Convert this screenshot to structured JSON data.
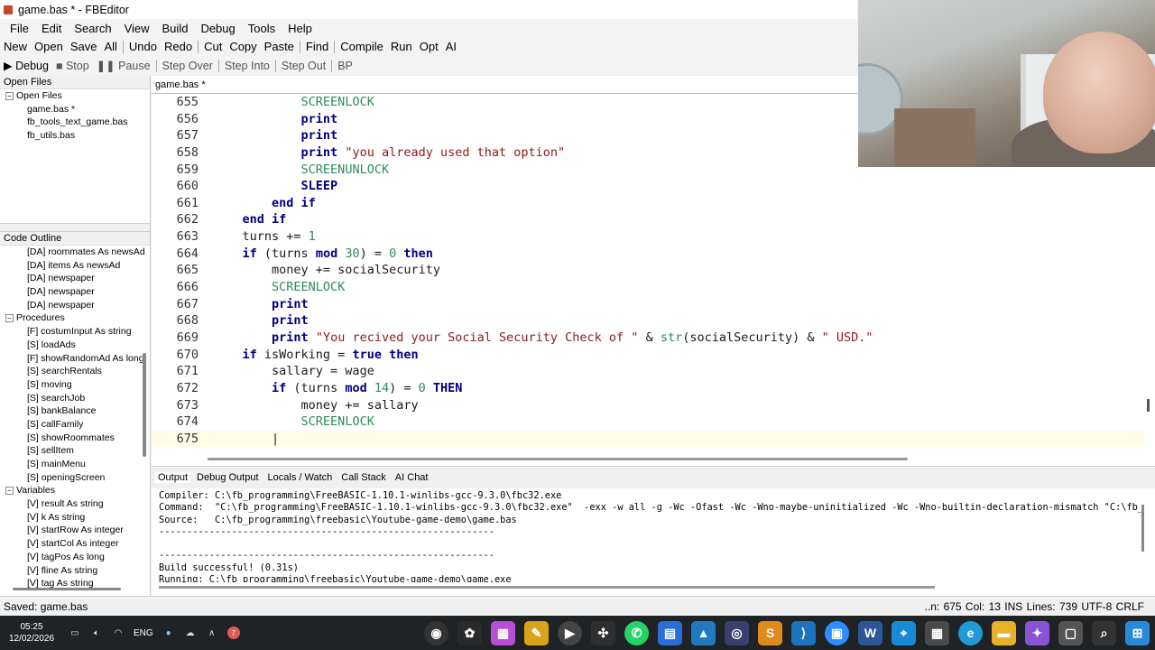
{
  "window": {
    "title": "game.bas * - FBEditor"
  },
  "menu": [
    "File",
    "Edit",
    "Search",
    "View",
    "Build",
    "Debug",
    "Tools",
    "Help"
  ],
  "toolbar": {
    "group1": [
      "New",
      "Open",
      "Save",
      "All"
    ],
    "group2": [
      "Undo",
      "Redo"
    ],
    "group3": [
      "Cut",
      "Copy",
      "Paste"
    ],
    "group4": [
      "Find"
    ],
    "group5": [
      "Compile",
      "Run",
      "Opt",
      "AI"
    ]
  },
  "debugbar": {
    "debug": "▶ Debug",
    "stop": "■ Stop",
    "pause": "❚❚ Pause",
    "step_over": "Step Over",
    "step_into": "Step Into",
    "step_out": "Step Out",
    "bp": "BP"
  },
  "open_files": {
    "header": "Open Files",
    "root": "Open Files",
    "items": [
      "game.bas *",
      "fb_tools_text_game.bas",
      "fb_utils.bas"
    ]
  },
  "code_outline": {
    "header": "Code Outline",
    "top_items": [
      "[DA] roommates As newsAd",
      "[DA] items As newsAd",
      "[DA] newspaper",
      "[DA] newspaper",
      "[DA] newspaper"
    ],
    "procedures_label": "Procedures",
    "procedures": [
      "[F] costumInput As string",
      "[S] loadAds",
      "[F] showRandomAd As long",
      "[S] searchRentals",
      "[S] moving",
      "[S] searchJob",
      "[S] bankBalance",
      "[S] callFamily",
      "[S] showRoommates",
      "[S] sellItem",
      "[S] mainMenu",
      "[S] openingScreen"
    ],
    "variables_label": "Variables",
    "variables": [
      "[V] result As string",
      "[V] k As string",
      "[V] startRow As integer",
      "[V] startCol As integer",
      "[V] tagPos As long",
      "[V] fline As string",
      "[V] tag As string"
    ]
  },
  "editor": {
    "tab": "game.bas *",
    "lines": [
      {
        "n": "655",
        "indent": 12,
        "tokens": [
          [
            "fn",
            "SCREENLOCK"
          ]
        ]
      },
      {
        "n": "656",
        "indent": 12,
        "tokens": [
          [
            "kw",
            "print"
          ]
        ]
      },
      {
        "n": "657",
        "indent": 12,
        "tokens": [
          [
            "kw",
            "print"
          ]
        ]
      },
      {
        "n": "658",
        "indent": 12,
        "tokens": [
          [
            "kw",
            "print"
          ],
          [
            "t",
            " "
          ],
          [
            "str",
            "\"you already used that option\""
          ]
        ]
      },
      {
        "n": "659",
        "indent": 12,
        "tokens": [
          [
            "fn",
            "SCREENUNLOCK"
          ]
        ]
      },
      {
        "n": "660",
        "indent": 12,
        "tokens": [
          [
            "kw",
            "SLEEP"
          ]
        ]
      },
      {
        "n": "661",
        "indent": 8,
        "tokens": [
          [
            "kw",
            "end if"
          ]
        ]
      },
      {
        "n": "662",
        "indent": 4,
        "tokens": [
          [
            "kw",
            "end if"
          ]
        ]
      },
      {
        "n": "663",
        "indent": 4,
        "tokens": [
          [
            "t",
            "turns += "
          ],
          [
            "num",
            "1"
          ]
        ]
      },
      {
        "n": "664",
        "indent": 4,
        "tokens": [
          [
            "kw",
            "if"
          ],
          [
            "t",
            " (turns "
          ],
          [
            "kw",
            "mod"
          ],
          [
            "t",
            " "
          ],
          [
            "num",
            "30"
          ],
          [
            "t",
            ") = "
          ],
          [
            "num",
            "0"
          ],
          [
            "t",
            " "
          ],
          [
            "kw",
            "then"
          ]
        ]
      },
      {
        "n": "665",
        "indent": 8,
        "tokens": [
          [
            "t",
            "money += socialSecurity"
          ]
        ]
      },
      {
        "n": "666",
        "indent": 8,
        "tokens": [
          [
            "fn",
            "SCREENLOCK"
          ]
        ]
      },
      {
        "n": "667",
        "indent": 8,
        "tokens": [
          [
            "kw",
            "print"
          ]
        ]
      },
      {
        "n": "668",
        "indent": 8,
        "tokens": [
          [
            "kw",
            "print"
          ]
        ]
      },
      {
        "n": "669",
        "indent": 8,
        "tokens": [
          [
            "kw",
            "print"
          ],
          [
            "t",
            " "
          ],
          [
            "str",
            "\"You recived your Social Security Check of \""
          ],
          [
            "t",
            " & "
          ],
          [
            "fn",
            "str"
          ],
          [
            "t",
            "(socialSecurity) & "
          ],
          [
            "str",
            "\" USD.\""
          ]
        ]
      },
      {
        "n": "670",
        "indent": 4,
        "tokens": [
          [
            "kw",
            "if"
          ],
          [
            "t",
            " isWorking = "
          ],
          [
            "kw",
            "true then"
          ]
        ]
      },
      {
        "n": "671",
        "indent": 8,
        "tokens": [
          [
            "t",
            "sallary = wage"
          ]
        ]
      },
      {
        "n": "672",
        "indent": 8,
        "tokens": [
          [
            "kw",
            "if"
          ],
          [
            "t",
            " (turns "
          ],
          [
            "kw",
            "mod"
          ],
          [
            "t",
            " "
          ],
          [
            "num",
            "14"
          ],
          [
            "t",
            ") = "
          ],
          [
            "num",
            "0"
          ],
          [
            "t",
            " "
          ],
          [
            "kw",
            "THEN"
          ]
        ]
      },
      {
        "n": "673",
        "indent": 12,
        "tokens": [
          [
            "t",
            "money += sallary"
          ]
        ]
      },
      {
        "n": "674",
        "indent": 12,
        "tokens": [
          [
            "fn",
            "SCREENLOCK"
          ]
        ]
      },
      {
        "n": "675",
        "indent": 8,
        "tokens": [
          [
            "t",
            "|"
          ]
        ],
        "current": true
      }
    ]
  },
  "bottom_tabs": [
    "Output",
    "Debug Output",
    "Locals / Watch",
    "Call Stack",
    "AI Chat"
  ],
  "output_lines": [
    "Compiler: C:\\fb_programming\\FreeBASIC-1.10.1-winlibs-gcc-9.3.0\\fbc32.exe",
    "Command:  \"C:\\fb_programming\\FreeBASIC-1.10.1-winlibs-gcc-9.3.0\\fbc32.exe\"  -exx -w all -g -Wc -Ofast -Wc -Wno-maybe-uninitialized -Wc -Wno-builtin-declaration-mismatch \"C:\\fb_progr",
    "Source:   C:\\fb_programming\\freebasic\\Youtube-game-demo\\game.bas",
    "------------------------------------------------------------",
    "",
    "------------------------------------------------------------",
    "Build successful! (0.31s)",
    "Running: C:\\fb_programming\\freebasic\\Youtube-game-demo\\game.exe"
  ],
  "status": {
    "left": "Saved: game.bas",
    "right": "..n: 675  Col: 13  INS  Lines: 739  UTF-8   CRLF"
  },
  "taskbar": {
    "time": "05:25",
    "date": "12/02/2026",
    "lang": "ENG",
    "notification_count": "7"
  }
}
